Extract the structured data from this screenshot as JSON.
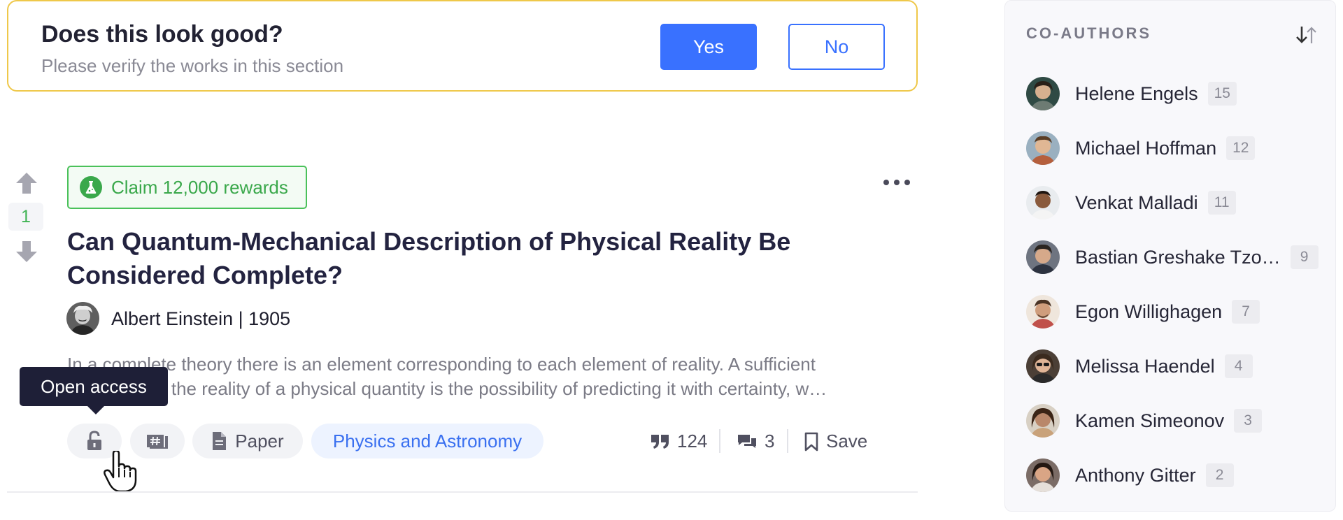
{
  "verify": {
    "question": "Does this look good?",
    "subtitle": "Please verify the works in this section",
    "yes_label": "Yes",
    "no_label": "No"
  },
  "vote": {
    "score": "1"
  },
  "paper": {
    "reward_label": "Claim 12,000 rewards",
    "title": "Can Quantum-Mechanical Description of Physical Reality Be Considered Complete?",
    "author": "Albert Einstein",
    "year": "1905",
    "author_line": "Albert Einstein | 1905",
    "abstract_line1": "In a complete theory there is an element corresponding to each element of reality. A sufficient",
    "abstract_line2": "condition for the reality of a physical quantity is the possibility of predicting it with certainty, w…",
    "tooltip": "Open access",
    "type_label": "Paper",
    "topic_label": "Physics and Astronomy",
    "citations": "124",
    "comments": "3",
    "save_label": "Save"
  },
  "coauthors": {
    "title": "CO-AUTHORS",
    "items": [
      {
        "name": "Helene Engels",
        "count": "15"
      },
      {
        "name": "Michael Hoffman",
        "count": "12"
      },
      {
        "name": "Venkat Malladi",
        "count": "11"
      },
      {
        "name": "Bastian Greshake Tzo…",
        "count": "9"
      },
      {
        "name": "Egon Willighagen",
        "count": "7"
      },
      {
        "name": "Melissa Haendel",
        "count": "4"
      },
      {
        "name": "Kamen Simeonov",
        "count": "3"
      },
      {
        "name": "Anthony Gitter",
        "count": "2"
      }
    ]
  },
  "colors": {
    "primary": "#3971ff",
    "success": "#3aa84b",
    "warning_border": "#efc84a",
    "tooltip_bg": "#1e1f37"
  },
  "icons": [
    "arrow-up-icon",
    "arrow-down-icon",
    "flask-icon",
    "ellipsis-icon",
    "lock-icon",
    "hash-icon",
    "document-icon",
    "quote-icon",
    "comment-icon",
    "bookmark-icon",
    "hand-cursor-icon",
    "sort-icon"
  ]
}
